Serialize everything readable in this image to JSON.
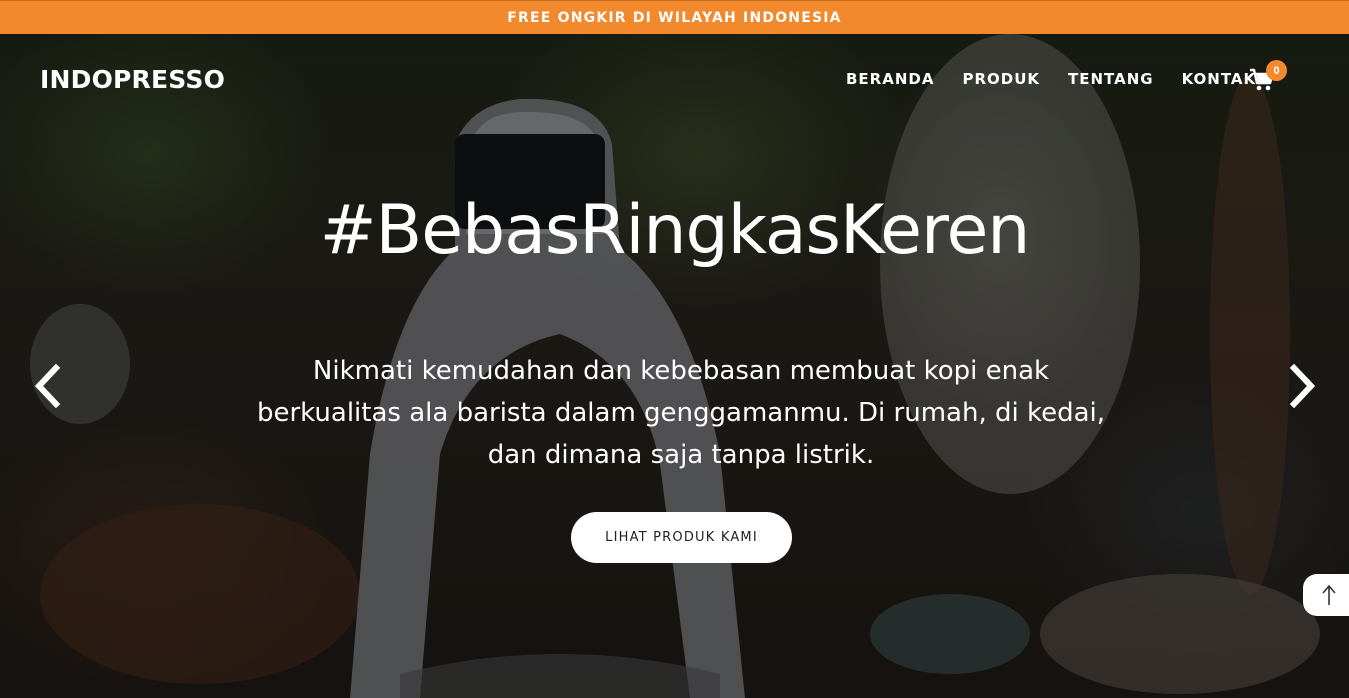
{
  "promo": {
    "text": "FREE ONGKIR DI WILAYAH INDONESIA"
  },
  "brand": {
    "name": "INDOPRESSO"
  },
  "nav": {
    "items": [
      {
        "label": "BERANDA"
      },
      {
        "label": "PRODUK"
      },
      {
        "label": "TENTANG"
      },
      {
        "label": "KONTAK"
      }
    ],
    "cart": {
      "icon": "cart-icon",
      "count": "0"
    }
  },
  "hero": {
    "headline": "#BebasRingkasKeren",
    "description": "Nikmati kemudahan dan kebebasan membuat kopi enak berkualitas ala barista dalam genggamanmu. Di rumah, di kedai, dan dimana saja tanpa listrik.",
    "cta_label": "LIHAT PRODUK KAMI",
    "prev_icon": "chevron-left-icon",
    "next_icon": "chevron-right-icon"
  },
  "scroll_top": {
    "icon": "arrow-up-icon"
  },
  "colors": {
    "accent": "#f3892d",
    "text": "#ffffff"
  }
}
